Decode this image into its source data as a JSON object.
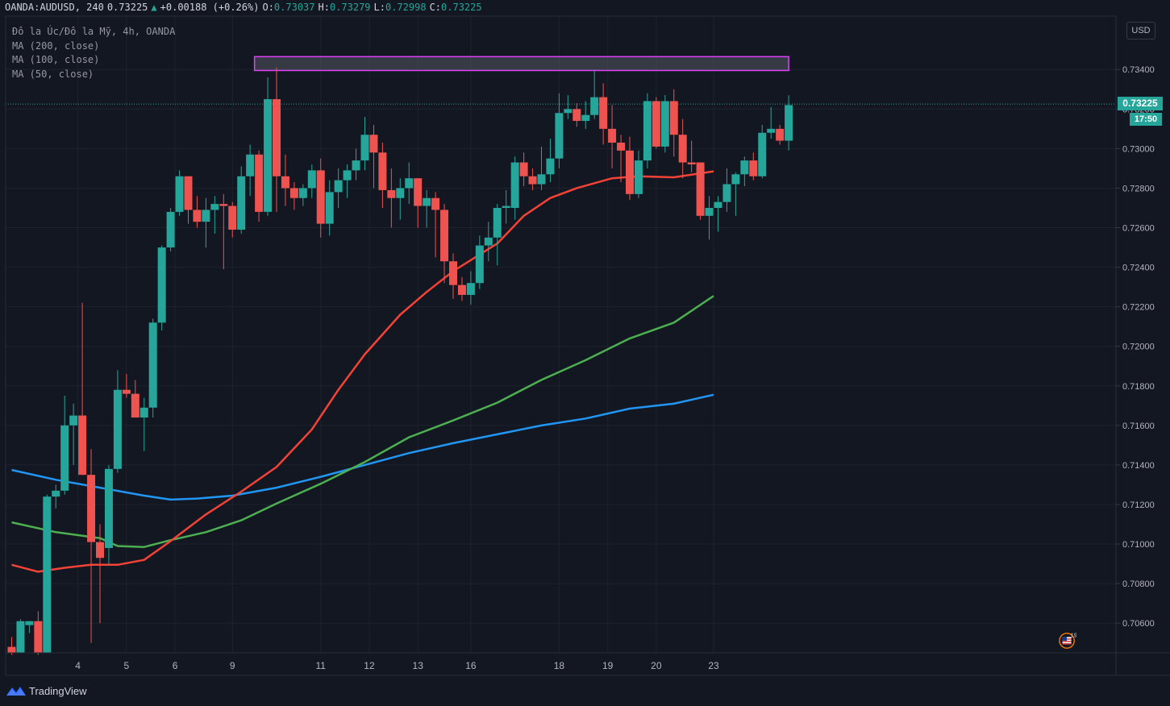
{
  "header": {
    "symbol": "OANDA:AUDUSD, 240",
    "last": "0.73225",
    "change_arrow": "▲",
    "change": "+0.00188 (+0.26%)",
    "o_label": "O:",
    "o_value": "0.73037",
    "h_label": "H:",
    "h_value": "0.73279",
    "l_label": "L:",
    "l_value": "0.72998",
    "c_label": "C:",
    "c_value": "0.73225"
  },
  "legend": {
    "title": "Đô la Úc/Đô la Mỹ, 4h, OANDA",
    "ma1": "MA (200, close)",
    "ma2": "MA (100, close)",
    "ma3": "MA (50, close)"
  },
  "axis": {
    "currency": "USD",
    "price_tag": "0.73225",
    "countdown": "17:50"
  },
  "branding": {
    "name": "TradingView",
    "icon": "tradingview-logo-icon"
  },
  "event": {
    "icon": "us-flag-icon",
    "count": "19"
  },
  "colors": {
    "background": "#131722",
    "up": "#26a69a",
    "down": "#ef5350",
    "ma200": "#2196f3",
    "ma100": "#4caf50",
    "ma50": "#f44336",
    "zone": "#e040fb"
  },
  "chart_data": {
    "type": "candlestick",
    "ylim": [
      0.7045,
      0.7367
    ],
    "yticks": [
      "0.73400",
      "0.73200",
      "0.73000",
      "0.72800",
      "0.72600",
      "0.72400",
      "0.72200",
      "0.72000",
      "0.71800",
      "0.71600",
      "0.71400",
      "0.71200",
      "0.71000",
      "0.70800",
      "0.70600"
    ],
    "xticks": [
      {
        "label": "4",
        "i": 7.5
      },
      {
        "label": "5",
        "i": 13
      },
      {
        "label": "6",
        "i": 18.5
      },
      {
        "label": "9",
        "i": 25
      },
      {
        "label": "11",
        "i": 35
      },
      {
        "label": "12",
        "i": 40.5
      },
      {
        "label": "13",
        "i": 46
      },
      {
        "label": "16",
        "i": 52
      },
      {
        "label": "18",
        "i": 62
      },
      {
        "label": "19",
        "i": 67.5
      },
      {
        "label": "20",
        "i": 73
      },
      {
        "label": "23",
        "i": 79.5
      }
    ],
    "zone": {
      "from_i": 27.5,
      "to_i": 88,
      "low": 0.73395,
      "high": 0.73465
    },
    "current_price": 0.73225,
    "candles": [
      [
        0.7048,
        0.7053,
        0.7044,
        0.7045
      ],
      [
        0.7045,
        0.7062,
        0.7045,
        0.7061
      ],
      [
        0.7059,
        0.7061,
        0.7055,
        0.7061
      ],
      [
        0.7061,
        0.7066,
        0.7044,
        0.7045
      ],
      [
        0.7045,
        0.7125,
        0.7045,
        0.7124
      ],
      [
        0.7124,
        0.713,
        0.7118,
        0.7127
      ],
      [
        0.7127,
        0.7175,
        0.7125,
        0.716
      ],
      [
        0.716,
        0.7171,
        0.714,
        0.7165
      ],
      [
        0.7165,
        0.7222,
        0.7135,
        0.7135
      ],
      [
        0.7135,
        0.7148,
        0.705,
        0.7101
      ],
      [
        0.7101,
        0.711,
        0.706,
        0.7093
      ],
      [
        0.7098,
        0.714,
        0.709,
        0.7138
      ],
      [
        0.7138,
        0.7188,
        0.7136,
        0.7178
      ],
      [
        0.7178,
        0.7186,
        0.7174,
        0.7176
      ],
      [
        0.7176,
        0.7183,
        0.7165,
        0.7164
      ],
      [
        0.7164,
        0.7174,
        0.7147,
        0.7169
      ],
      [
        0.7169,
        0.7214,
        0.7164,
        0.7212
      ],
      [
        0.7212,
        0.7251,
        0.7208,
        0.725
      ],
      [
        0.725,
        0.727,
        0.7248,
        0.7268
      ],
      [
        0.7268,
        0.7289,
        0.7266,
        0.7286
      ],
      [
        0.7286,
        0.7286,
        0.7262,
        0.7269
      ],
      [
        0.7269,
        0.7276,
        0.726,
        0.7263
      ],
      [
        0.7263,
        0.7275,
        0.725,
        0.7269
      ],
      [
        0.7269,
        0.7276,
        0.7257,
        0.7272
      ],
      [
        0.7272,
        0.7277,
        0.7239,
        0.7271
      ],
      [
        0.7271,
        0.7273,
        0.7255,
        0.7259
      ],
      [
        0.7259,
        0.7291,
        0.7257,
        0.7286
      ],
      [
        0.7286,
        0.7302,
        0.7276,
        0.7297
      ],
      [
        0.7297,
        0.7299,
        0.7263,
        0.7268
      ],
      [
        0.7268,
        0.7336,
        0.7266,
        0.7325
      ],
      [
        0.7325,
        0.7341,
        0.7268,
        0.7286
      ],
      [
        0.7286,
        0.7297,
        0.7271,
        0.728
      ],
      [
        0.728,
        0.7283,
        0.7269,
        0.7275
      ],
      [
        0.7275,
        0.7282,
        0.7271,
        0.728
      ],
      [
        0.728,
        0.7292,
        0.7275,
        0.7289
      ],
      [
        0.7289,
        0.7295,
        0.7255,
        0.7262
      ],
      [
        0.7262,
        0.7284,
        0.7256,
        0.7278
      ],
      [
        0.7278,
        0.729,
        0.727,
        0.7284
      ],
      [
        0.7284,
        0.7292,
        0.7275,
        0.7289
      ],
      [
        0.7289,
        0.73,
        0.7284,
        0.7294
      ],
      [
        0.7294,
        0.7316,
        0.7289,
        0.7307
      ],
      [
        0.7307,
        0.7312,
        0.728,
        0.7298
      ],
      [
        0.7298,
        0.7303,
        0.727,
        0.7279
      ],
      [
        0.7279,
        0.729,
        0.726,
        0.7275
      ],
      [
        0.7275,
        0.7285,
        0.7264,
        0.728
      ],
      [
        0.728,
        0.7293,
        0.7272,
        0.7285
      ],
      [
        0.7285,
        0.7284,
        0.726,
        0.7271
      ],
      [
        0.7271,
        0.7279,
        0.726,
        0.7275
      ],
      [
        0.7275,
        0.7278,
        0.7245,
        0.7269
      ],
      [
        0.7269,
        0.7272,
        0.7232,
        0.7243
      ],
      [
        0.7243,
        0.7247,
        0.7224,
        0.7231
      ],
      [
        0.7231,
        0.7235,
        0.7223,
        0.7226
      ],
      [
        0.7226,
        0.7238,
        0.7221,
        0.7232
      ],
      [
        0.7232,
        0.7256,
        0.7229,
        0.7251
      ],
      [
        0.7251,
        0.7263,
        0.7243,
        0.7255
      ],
      [
        0.7255,
        0.7272,
        0.7241,
        0.727
      ],
      [
        0.727,
        0.7279,
        0.7262,
        0.7271
      ],
      [
        0.727,
        0.7296,
        0.7264,
        0.7293
      ],
      [
        0.7293,
        0.7298,
        0.7281,
        0.7286
      ],
      [
        0.7286,
        0.729,
        0.7279,
        0.7282
      ],
      [
        0.7282,
        0.7301,
        0.7279,
        0.7287
      ],
      [
        0.7287,
        0.7305,
        0.7283,
        0.7295
      ],
      [
        0.7295,
        0.7328,
        0.729,
        0.7318
      ],
      [
        0.7318,
        0.7327,
        0.7315,
        0.732
      ],
      [
        0.732,
        0.7323,
        0.7311,
        0.7314
      ],
      [
        0.7314,
        0.7324,
        0.731,
        0.7317
      ],
      [
        0.7317,
        0.734,
        0.7315,
        0.7326
      ],
      [
        0.7326,
        0.7333,
        0.7302,
        0.731
      ],
      [
        0.731,
        0.7322,
        0.729,
        0.7303
      ],
      [
        0.7303,
        0.7307,
        0.7283,
        0.7299
      ],
      [
        0.7299,
        0.7306,
        0.7274,
        0.7277
      ],
      [
        0.7277,
        0.7299,
        0.7275,
        0.7294
      ],
      [
        0.7294,
        0.7328,
        0.729,
        0.7324
      ],
      [
        0.7324,
        0.7326,
        0.73,
        0.7301
      ],
      [
        0.7301,
        0.7327,
        0.7298,
        0.7324
      ],
      [
        0.7324,
        0.733,
        0.7296,
        0.7307
      ],
      [
        0.7307,
        0.7315,
        0.7285,
        0.7293
      ],
      [
        0.7293,
        0.7304,
        0.7288,
        0.7292
      ],
      [
        0.7293,
        0.7293,
        0.7264,
        0.7266
      ],
      [
        0.7266,
        0.7276,
        0.7254,
        0.727
      ],
      [
        0.727,
        0.7276,
        0.7258,
        0.7273
      ],
      [
        0.7273,
        0.729,
        0.7268,
        0.7282
      ],
      [
        0.7282,
        0.7288,
        0.7266,
        0.7287
      ],
      [
        0.7287,
        0.7296,
        0.7281,
        0.7294
      ],
      [
        0.7294,
        0.7298,
        0.7284,
        0.7286
      ],
      [
        0.7286,
        0.7312,
        0.7285,
        0.7308
      ],
      [
        0.7308,
        0.7321,
        0.7305,
        0.731
      ],
      [
        0.731,
        0.7312,
        0.7302,
        0.7304
      ],
      [
        0.7304,
        0.7327,
        0.7299,
        0.7322
      ]
    ],
    "series": [
      {
        "key": "ma200",
        "points": [
          [
            0,
            0.71375
          ],
          [
            5,
            0.71325
          ],
          [
            10,
            0.71285
          ],
          [
            15,
            0.71245
          ],
          [
            18,
            0.71225
          ],
          [
            21,
            0.7123
          ],
          [
            25,
            0.71245
          ],
          [
            30,
            0.71285
          ],
          [
            35,
            0.7134
          ],
          [
            40,
            0.714
          ],
          [
            45,
            0.7146
          ],
          [
            50,
            0.7151
          ],
          [
            55,
            0.71555
          ],
          [
            60,
            0.716
          ],
          [
            65,
            0.71635
          ],
          [
            70,
            0.71685
          ],
          [
            75,
            0.7171
          ],
          [
            79.5,
            0.71755
          ]
        ]
      },
      {
        "key": "ma100",
        "points": [
          [
            0,
            0.7111
          ],
          [
            5,
            0.7106
          ],
          [
            10,
            0.7103
          ],
          [
            12,
            0.7099
          ],
          [
            15,
            0.70985
          ],
          [
            18,
            0.7102
          ],
          [
            22,
            0.7106
          ],
          [
            26,
            0.7112
          ],
          [
            30,
            0.71205
          ],
          [
            35,
            0.71305
          ],
          [
            40,
            0.71415
          ],
          [
            45,
            0.7154
          ],
          [
            50,
            0.71625
          ],
          [
            55,
            0.71715
          ],
          [
            60,
            0.7183
          ],
          [
            65,
            0.7193
          ],
          [
            70,
            0.7204
          ],
          [
            75,
            0.7212
          ],
          [
            79.5,
            0.72255
          ]
        ]
      },
      {
        "key": "ma50",
        "points": [
          [
            0,
            0.70895
          ],
          [
            3,
            0.7086
          ],
          [
            6,
            0.7088
          ],
          [
            9,
            0.70895
          ],
          [
            12,
            0.70895
          ],
          [
            15,
            0.7092
          ],
          [
            18,
            0.71015
          ],
          [
            22,
            0.7115
          ],
          [
            26,
            0.71265
          ],
          [
            30,
            0.7139
          ],
          [
            34,
            0.7158
          ],
          [
            37,
            0.7178
          ],
          [
            40,
            0.7196
          ],
          [
            44,
            0.7216
          ],
          [
            47,
            0.72275
          ],
          [
            50,
            0.7238
          ],
          [
            55,
            0.7252
          ],
          [
            58,
            0.7266
          ],
          [
            61,
            0.7275
          ],
          [
            64,
            0.728
          ],
          [
            68,
            0.7285
          ],
          [
            71,
            0.7286
          ],
          [
            75,
            0.72855
          ],
          [
            79.5,
            0.72885
          ]
        ]
      }
    ]
  }
}
